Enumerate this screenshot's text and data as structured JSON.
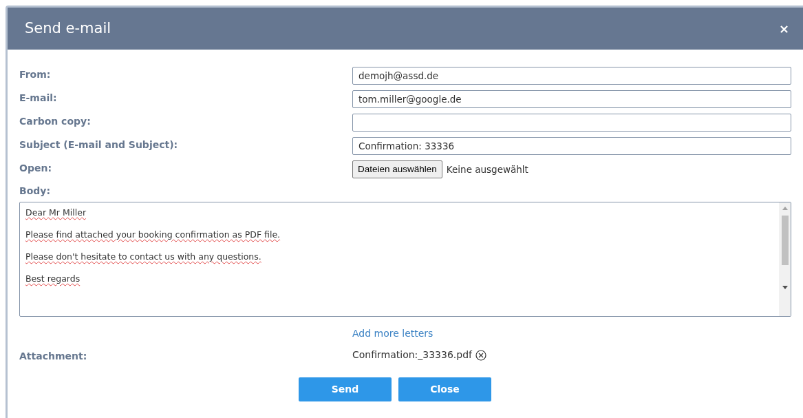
{
  "window": {
    "title": "Send e-mail",
    "close": "×"
  },
  "fields": [
    {
      "label": "From:",
      "kind": "text",
      "value": "demojh@assd.de"
    },
    {
      "label": "E-mail:",
      "kind": "text",
      "value": "tom.miller@google.de"
    },
    {
      "label": "Carbon copy:",
      "kind": "text"
    },
    {
      "label": "Subject (E-mail and Subject):",
      "kind": "text",
      "value": "Confirmation: 33336"
    },
    {
      "label": "Open:",
      "kind": "file",
      "button": "Dateien auswählen",
      "value": "Keine ausgewählt"
    }
  ],
  "body": {
    "label": "Body:",
    "paragraphs": [
      "Dear Mr Miller",
      "Please find attached your booking confirmation as PDF file.",
      "Please don't hesitate to contact us with any questions.",
      "Best regards"
    ]
  },
  "add_more_link": "Add more letters",
  "attachment": {
    "label": "Attachment:",
    "file": "Confirmation:_33336.pdf"
  },
  "buttons": [
    "Send",
    "Close"
  ]
}
